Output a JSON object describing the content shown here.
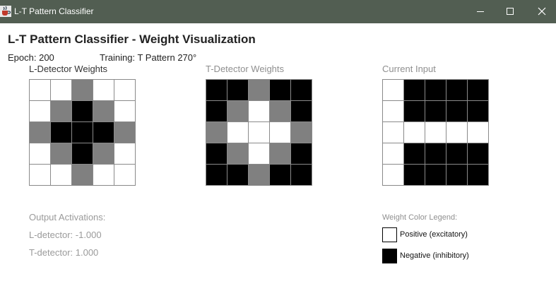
{
  "window": {
    "title": "L-T Pattern Classifier",
    "icon": "java-coffee-cup-icon",
    "titlebar_color": "#525e52",
    "controls": [
      "minimize-icon",
      "maximize-icon",
      "close-icon"
    ]
  },
  "header": {
    "title": "L-T Pattern Classifier - Weight Visualization",
    "epoch": "Epoch: 200",
    "training": "Training: T Pattern 270°"
  },
  "grids": [
    {
      "label": "L-Detector Weights",
      "cells": [
        [
          "w",
          "w",
          "g",
          "w",
          "w"
        ],
        [
          "w",
          "g",
          "b",
          "g",
          "w"
        ],
        [
          "g",
          "b",
          "b",
          "b",
          "g"
        ],
        [
          "w",
          "g",
          "b",
          "g",
          "w"
        ],
        [
          "w",
          "w",
          "g",
          "w",
          "w"
        ]
      ]
    },
    {
      "label": "T-Detector Weights",
      "cells": [
        [
          "b",
          "b",
          "g",
          "b",
          "b"
        ],
        [
          "b",
          "g",
          "w",
          "g",
          "b"
        ],
        [
          "g",
          "w",
          "w",
          "w",
          "g"
        ],
        [
          "b",
          "g",
          "w",
          "g",
          "b"
        ],
        [
          "b",
          "b",
          "g",
          "b",
          "b"
        ]
      ]
    },
    {
      "label": "Current Input",
      "cells": [
        [
          "w",
          "b",
          "b",
          "b",
          "b"
        ],
        [
          "w",
          "b",
          "b",
          "b",
          "b"
        ],
        [
          "w",
          "w",
          "w",
          "w",
          "w"
        ],
        [
          "w",
          "b",
          "b",
          "b",
          "b"
        ],
        [
          "w",
          "b",
          "b",
          "b",
          "b"
        ]
      ]
    }
  ],
  "outputs": {
    "heading": "Output Activations:",
    "l_detector": "L-detector: -1.000",
    "t_detector": "T-detector: 1.000"
  },
  "legend": {
    "heading": "Weight Color Legend:",
    "positive": "Positive (excitatory)",
    "negative": "Negative (inhibitory)",
    "positive_color": "#ffffff",
    "negative_color": "#000000",
    "neutral_color": "#808080"
  }
}
